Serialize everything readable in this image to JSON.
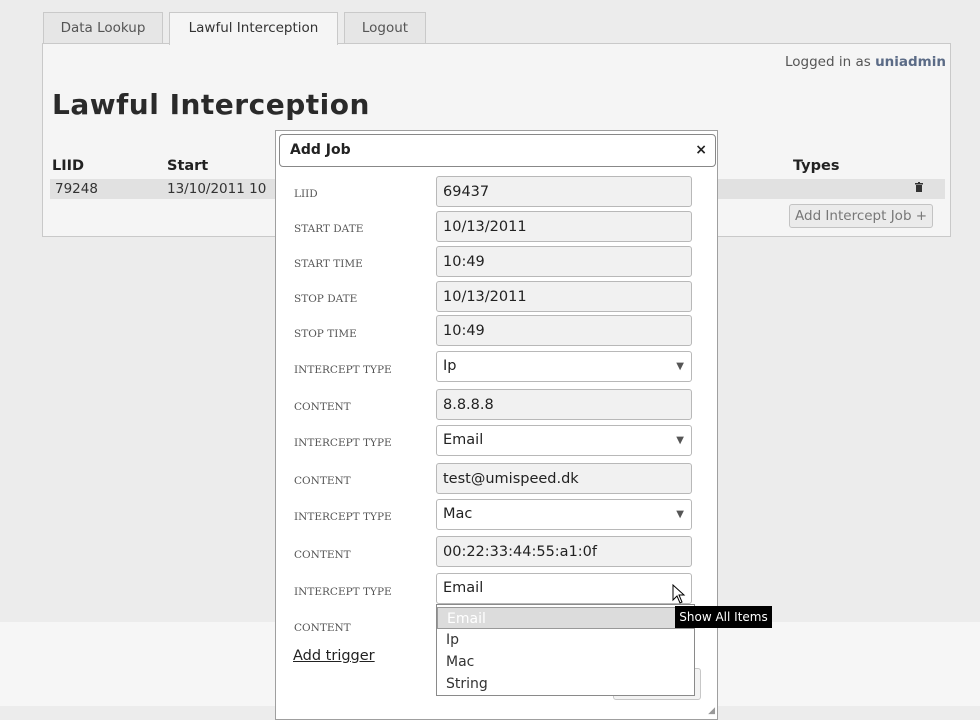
{
  "tabs": [
    {
      "label": "Data Lookup"
    },
    {
      "label": "Lawful Interception"
    },
    {
      "label": "Logout"
    }
  ],
  "header": {
    "logged_in_prefix": "Logged in as",
    "username": "uniadmin"
  },
  "page": {
    "title": "Lawful Interception"
  },
  "table": {
    "columns": [
      "LIID",
      "Start",
      "Types"
    ],
    "rows": [
      {
        "liid": "79248",
        "start": "13/10/2011 10"
      }
    ],
    "delete_icon": "trash-icon",
    "add_button_label": "Add Intercept Job +"
  },
  "modal": {
    "title": "Add Job",
    "close_glyph": "×",
    "fields": [
      {
        "label": "LIID",
        "value": "69437"
      },
      {
        "label": "START DATE",
        "value": "10/13/2011"
      },
      {
        "label": "START TIME",
        "value": "10:49"
      },
      {
        "label": "STOP DATE",
        "value": "10/13/2011"
      },
      {
        "label": "STOP TIME",
        "value": "10:49"
      },
      {
        "label": "INTERCEPT TYPE",
        "value": "Ip"
      },
      {
        "label": "CONTENT",
        "value": "8.8.8.8"
      },
      {
        "label": "INTERCEPT TYPE",
        "value": "Email"
      },
      {
        "label": "CONTENT",
        "value": "test@umispeed.dk"
      },
      {
        "label": "INTERCEPT TYPE",
        "value": "Mac"
      },
      {
        "label": "CONTENT",
        "value": "00:22:33:44:55:a1:0f"
      },
      {
        "label": "INTERCEPT TYPE",
        "value": "Email"
      },
      {
        "label": "CONTENT",
        "value": ""
      }
    ],
    "add_trigger_label": "Add trigger"
  },
  "dropdown": {
    "options": [
      "Email",
      "Ip",
      "Mac",
      "String"
    ],
    "selected": "Email"
  },
  "tooltip": {
    "text": "Show All Items"
  }
}
